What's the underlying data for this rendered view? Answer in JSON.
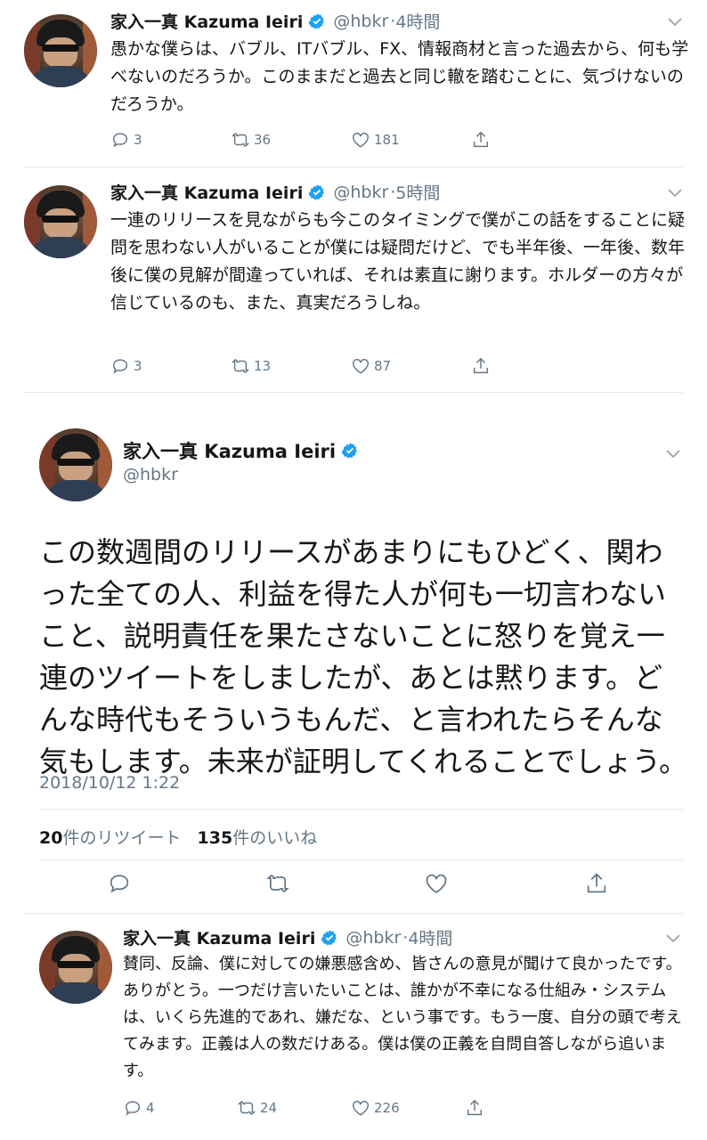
{
  "tweets_above": [
    {
      "name": "家入一真 Kazuma Ieiri",
      "handle": "@hbkr",
      "time": "4時間",
      "text": "愚かな僕らは、バブル、ITバブル、FX、情報商材と言った過去から、何も学べないのだろうか。このままだと過去と同じ轍を踏むことに、気づけないのだろうか。",
      "replies": "3",
      "retweets": "36",
      "likes": "181"
    },
    {
      "name": "家入一真 Kazuma Ieiri",
      "handle": "@hbkr",
      "time": "5時間",
      "text": "一連のリリースを見ながらも今このタイミングで僕がこの話をすることに疑問を思わない人がいることが僕には疑問だけど、でも半年後、一年後、数年後に僕の見解が間違っていれば、それは素直に謝ります。ホルダーの方々が信じているのも、また、真実だろうしね。",
      "replies": "3",
      "retweets": "13",
      "likes": "87"
    }
  ],
  "main_tweet": {
    "name": "家入一真 Kazuma Ieiri",
    "handle": "@hbkr",
    "text": "この数週間のリリースがあまりにもひどく、関わった全ての人、利益を得た人が何も一切言わないこと、説明責任を果たさないことに怒りを覚え一連のツイートをしましたが、あとは黙ります。どんな時代もそういうもんだ、と言われたらそんな気もします。未来が証明してくれることでしょう。",
    "timestamp": "2018/10/12 1:22",
    "retweet_count": "20",
    "retweet_label": "件のリツイート",
    "like_count": "135",
    "like_label": "件のいいね"
  },
  "reply_tweet": {
    "name": "家入一真 Kazuma Ieiri",
    "handle": "@hbkr",
    "time": "4時間",
    "text": "賛同、反論、僕に対しての嫌悪感含め、皆さんの意見が聞けて良かったです。ありがとう。一つだけ言いたいことは、誰かが不幸になる仕組み・システムは、いくら先進的であれ、嫌だな、という事です。もう一度、自分の頭で考えてみます。正義は人の数だけある。僕は僕の正義を自問自答しながら追います。",
    "replies": "4",
    "retweets": "24",
    "likes": "226"
  },
  "colors": {
    "verified": "#1da1f2",
    "secondary_text": "#657786",
    "divider": "#e1e8ed"
  },
  "icons": [
    "reply-icon",
    "retweet-icon",
    "like-icon",
    "share-icon",
    "verified-badge-icon",
    "chevron-down-icon"
  ]
}
